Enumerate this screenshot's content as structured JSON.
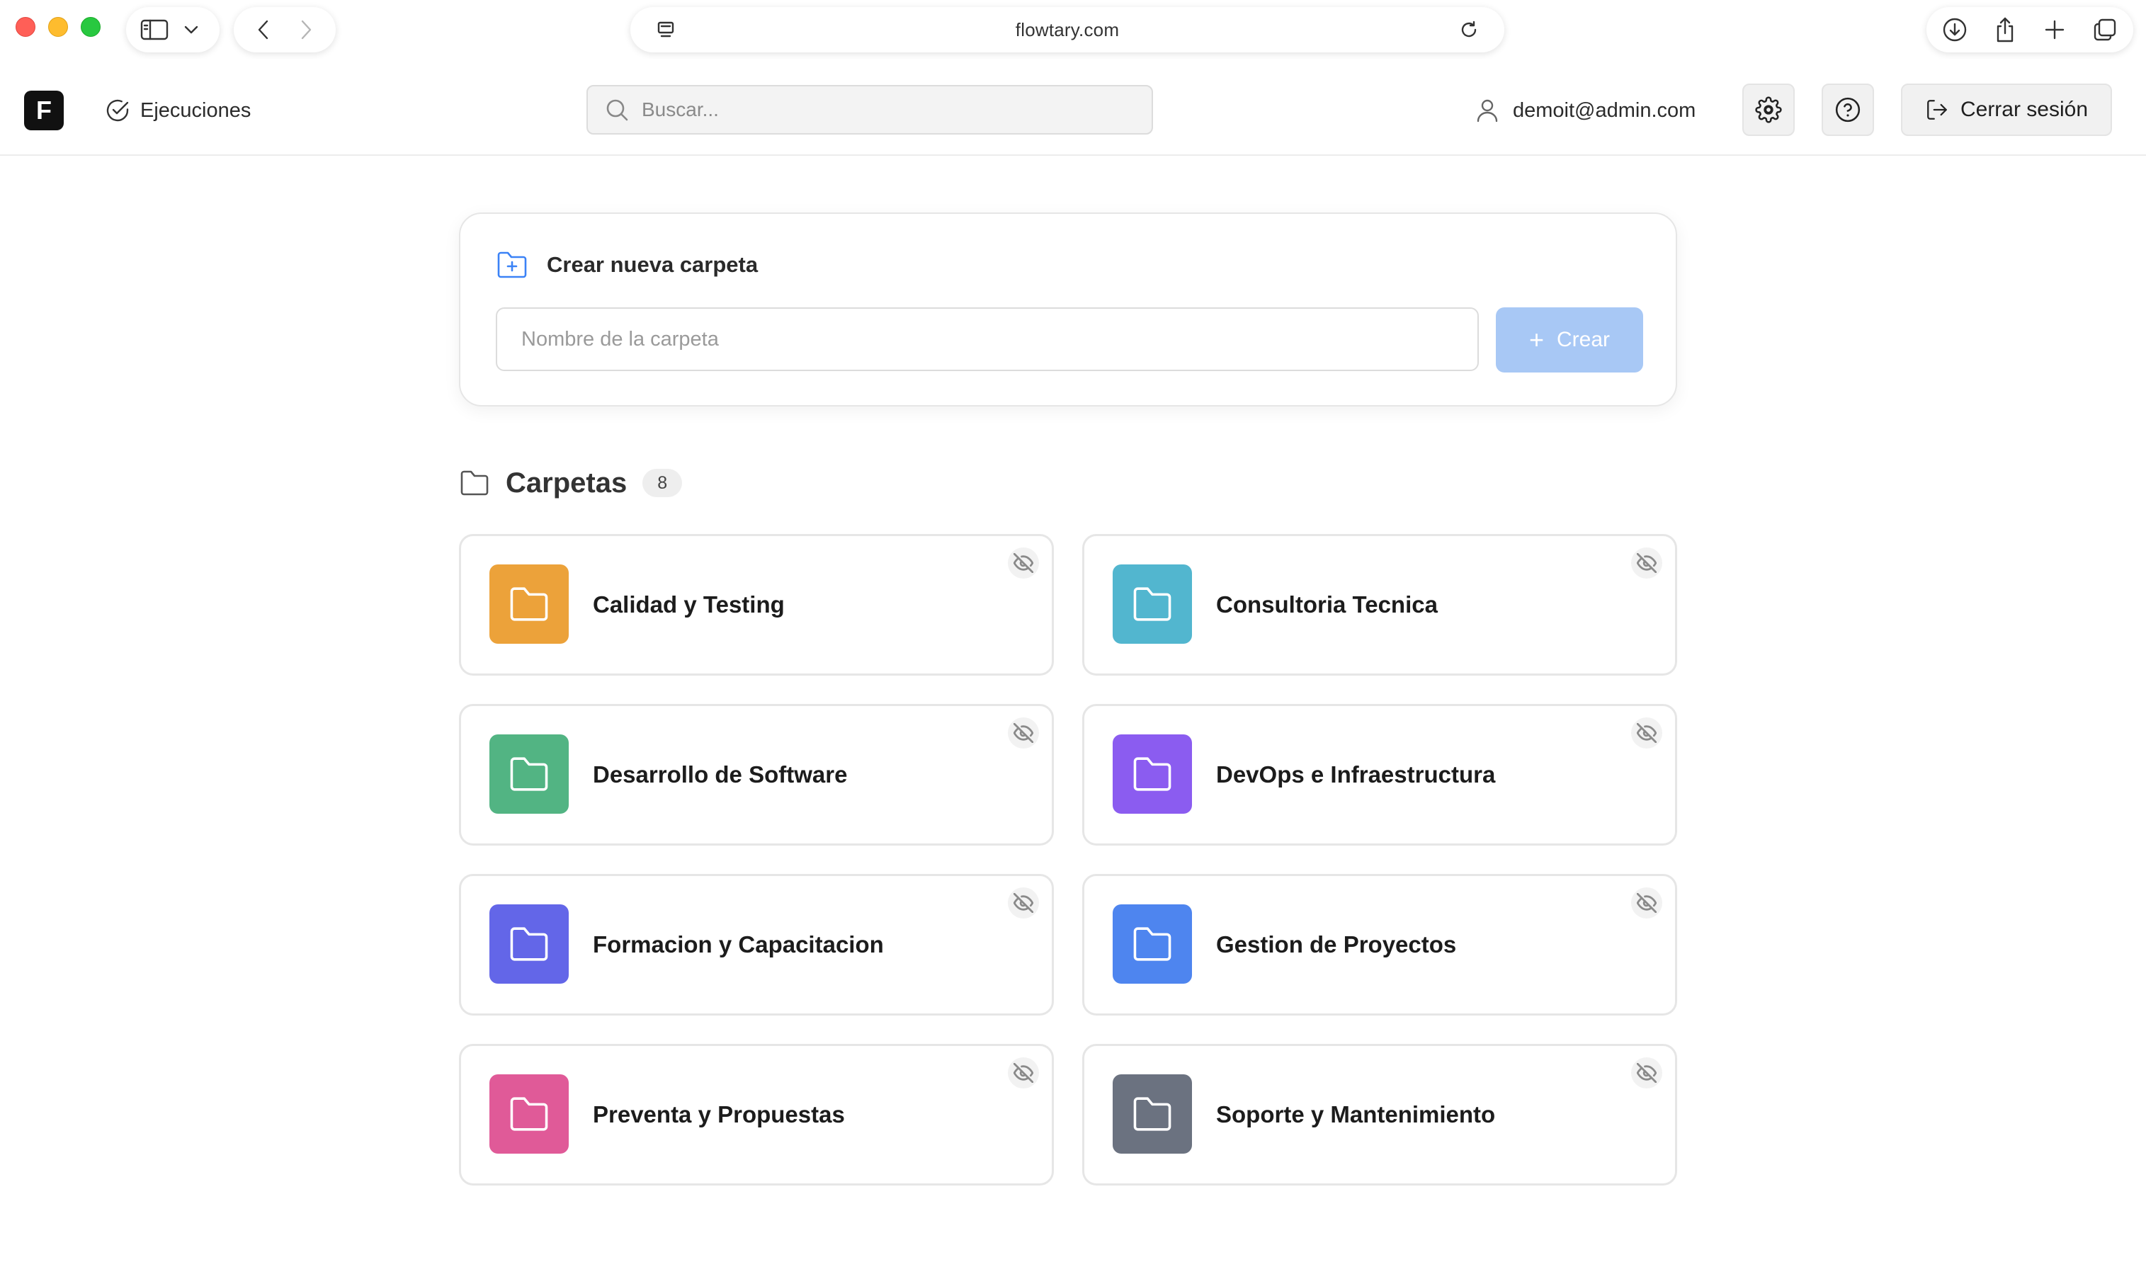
{
  "browser": {
    "url": "flowtary.com"
  },
  "header": {
    "logo_letter": "F",
    "nav_executions": "Ejecuciones",
    "search_placeholder": "Buscar...",
    "user_email": "demoit@admin.com",
    "logout_label": "Cerrar sesión"
  },
  "create_folder": {
    "title": "Crear nueva carpeta",
    "input_placeholder": "Nombre de la carpeta",
    "create_label": "Crear",
    "accent_color": "#3b82f6",
    "button_color": "#a8c8f5"
  },
  "folders_section": {
    "title": "Carpetas",
    "count": "8"
  },
  "folders": [
    {
      "name": "Calidad y Testing",
      "color": "#eca23a"
    },
    {
      "name": "Consultoria Tecnica",
      "color": "#52b6cf"
    },
    {
      "name": "Desarrollo de Software",
      "color": "#52b483"
    },
    {
      "name": "DevOps e Infraestructura",
      "color": "#8b5cf0"
    },
    {
      "name": "Formacion y Capacitacion",
      "color": "#6366e8"
    },
    {
      "name": "Gestion de Proyectos",
      "color": "#4e85ef"
    },
    {
      "name": "Preventa y Propuestas",
      "color": "#e05a98"
    },
    {
      "name": "Soporte y Mantenimiento",
      "color": "#6b7280"
    }
  ]
}
